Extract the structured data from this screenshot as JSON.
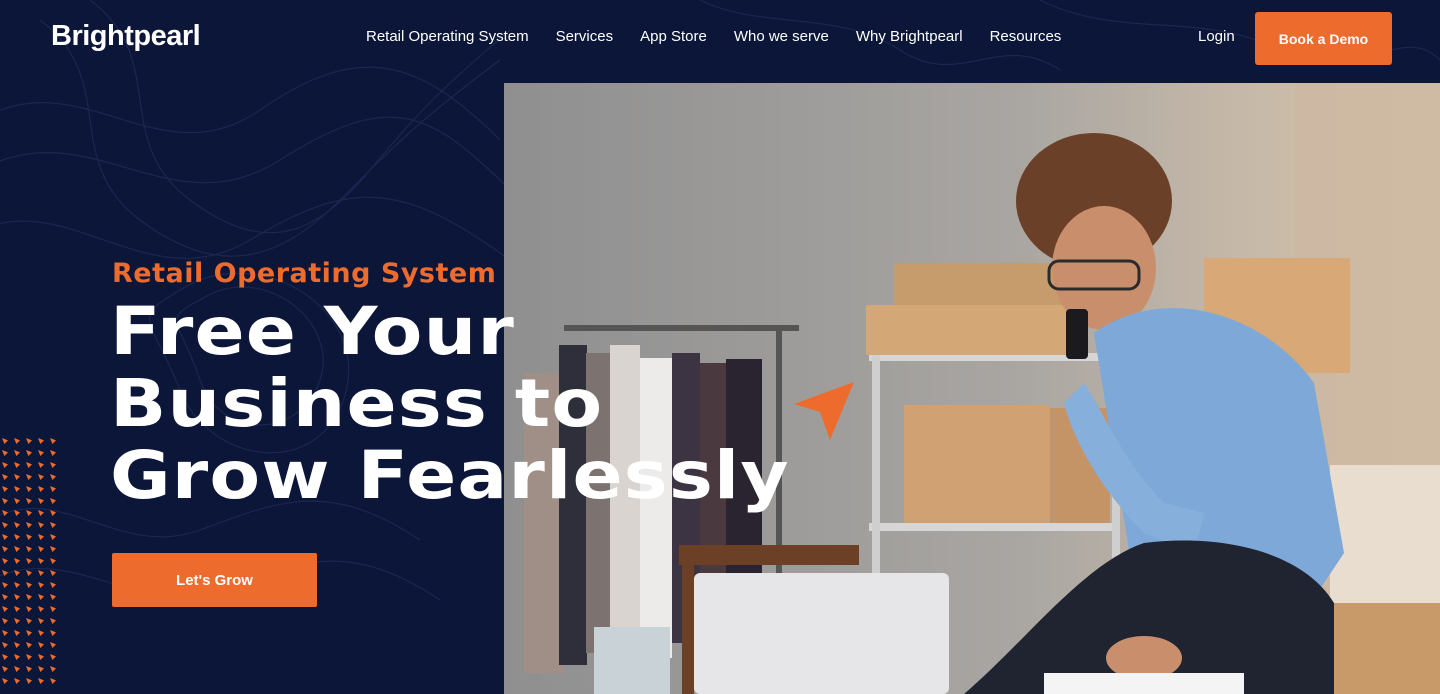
{
  "header": {
    "logo_text": "Brightpearl",
    "nav": [
      {
        "label": "Retail Operating System"
      },
      {
        "label": "Services"
      },
      {
        "label": "App Store"
      },
      {
        "label": "Who we serve"
      },
      {
        "label": "Why Brightpearl"
      },
      {
        "label": "Resources"
      }
    ],
    "login_label": "Login",
    "demo_label": "Book a Demo"
  },
  "hero": {
    "eyebrow": "Retail Operating System",
    "headline_lines": [
      "Free Your",
      "Business to",
      "Grow Fearlessly"
    ],
    "cta_label": "Let's Grow"
  },
  "icons": {
    "cursor": "pointer-arrow-icon",
    "pattern": "arrow-dot-pattern"
  },
  "colors": {
    "background": "#0b1638",
    "accent": "#ee6b2e",
    "text": "#ffffff"
  }
}
